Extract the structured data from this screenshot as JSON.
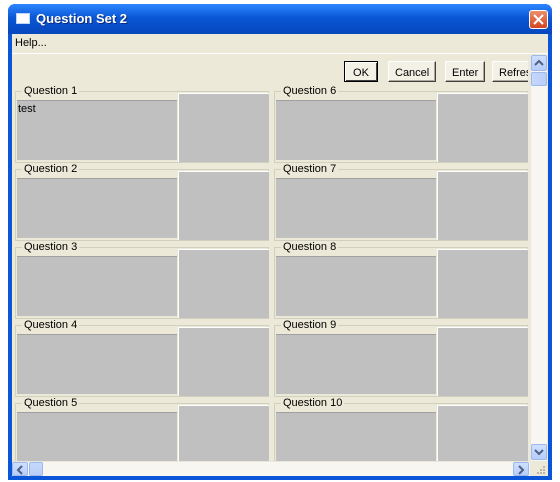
{
  "window": {
    "title": "Question Set 2",
    "colors": {
      "titlebar": "#0a57d6",
      "client": "#ece9d8",
      "answer_box": "#c0c0c0",
      "close_button": "#d4451f"
    }
  },
  "menu": {
    "help": "Help..."
  },
  "toolbar": {
    "ok": "OK",
    "cancel": "Cancel",
    "enter": "Enter",
    "refresh": "Refresh"
  },
  "questions": [
    {
      "label": "Question 1",
      "answer": "test"
    },
    {
      "label": "Question 2",
      "answer": ""
    },
    {
      "label": "Question 3",
      "answer": ""
    },
    {
      "label": "Question 4",
      "answer": ""
    },
    {
      "label": "Question 5",
      "answer": ""
    },
    {
      "label": "Question 6",
      "answer": ""
    },
    {
      "label": "Question 7",
      "answer": ""
    },
    {
      "label": "Question 8",
      "answer": ""
    },
    {
      "label": "Question 9",
      "answer": ""
    },
    {
      "label": "Question 10",
      "answer": ""
    }
  ],
  "icons": {
    "app": "window-icon",
    "close": "close-icon",
    "scroll_up": "chevron-up-icon",
    "scroll_down": "chevron-down-icon",
    "scroll_left": "chevron-left-icon",
    "scroll_right": "chevron-right-icon",
    "resize": "resize-grip-icon"
  }
}
